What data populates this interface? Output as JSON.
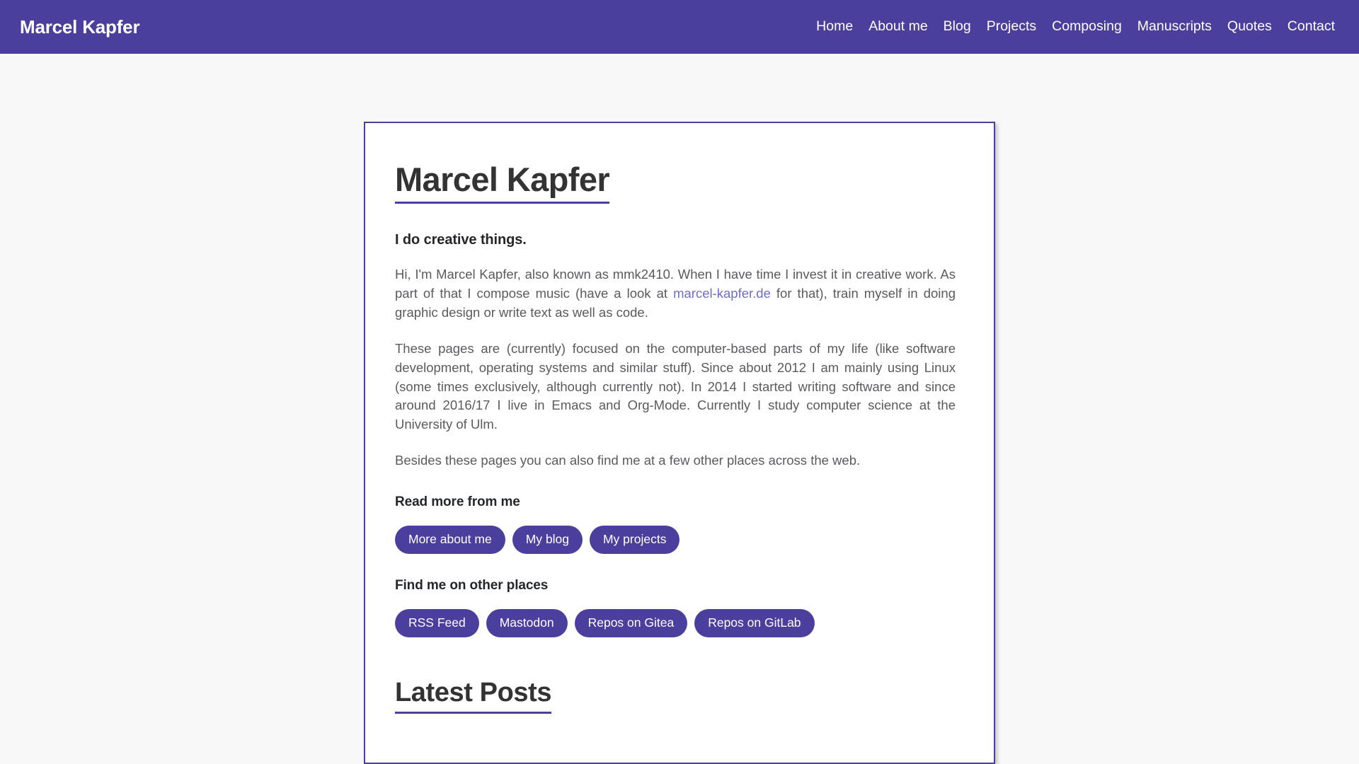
{
  "header": {
    "brand": "Marcel Kapfer",
    "brand_color": "#ffffff",
    "background_color": "#4b3f9e",
    "nav": [
      {
        "label": "Home"
      },
      {
        "label": "About me"
      },
      {
        "label": "Blog"
      },
      {
        "label": "Projects"
      },
      {
        "label": "Composing"
      },
      {
        "label": "Manuscripts"
      },
      {
        "label": "Quotes"
      },
      {
        "label": "Contact"
      }
    ]
  },
  "main": {
    "page_title": "Marcel Kapfer",
    "tagline": "I do creative things.",
    "paragraph_1": {
      "before_link": "Hi, I'm Marcel Kapfer, also known as mmk2410. When I have time I invest it in creative work. As part of that I compose music (have a look at ",
      "link_text": "marcel-kapfer.de",
      "after_link": " for that), train myself in doing graphic design or write text as well as code."
    },
    "paragraph_2": "These pages are (currently) focused on the computer-based parts of my life (like software development, operating systems and similar stuff). Since about 2012 I am mainly using Linux (some times exclusively, although currently not). In 2014 I started writing software and since around 2016/17 I live in Emacs and Org-Mode. Currently I study computer science at the University of Ulm.",
    "paragraph_3": "Besides these pages you can also find me at a few other places across the web.",
    "read_more_heading": "Read more from me",
    "read_more_buttons": [
      {
        "label": "More about me"
      },
      {
        "label": "My blog"
      },
      {
        "label": "My projects"
      }
    ],
    "other_places_heading": "Find me on other places",
    "other_places_buttons": [
      {
        "label": "RSS Feed"
      },
      {
        "label": "Mastodon"
      },
      {
        "label": "Repos on Gitea"
      },
      {
        "label": "Repos on GitLab"
      }
    ],
    "latest_posts_heading": "Latest Posts"
  },
  "theme": {
    "accent": "#4b3f9e",
    "page_background": "#f8f8f9",
    "card_background": "#ffffff",
    "body_text_color": "#5a5a60",
    "heading_text_color": "#333333",
    "link_color": "#6d6ec4"
  }
}
